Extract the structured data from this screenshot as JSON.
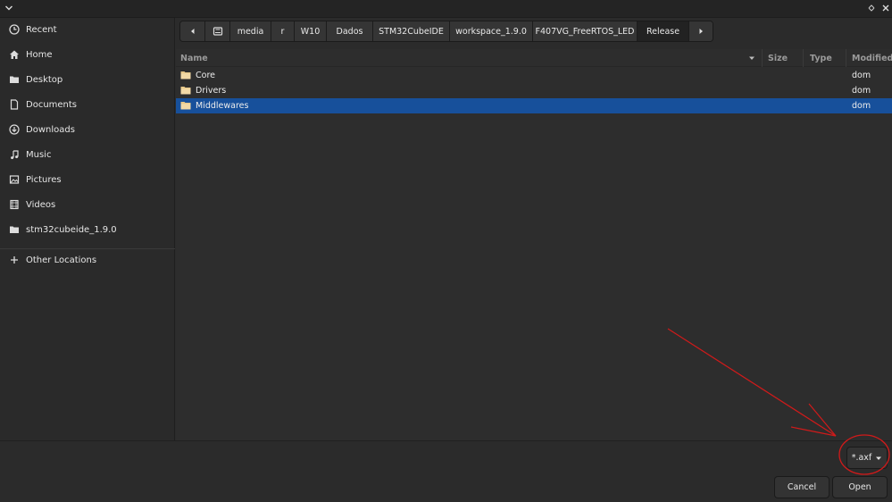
{
  "window": {
    "menu_icon": "chevron-down-icon",
    "maximize_icon": "maximize-icon",
    "close_icon": "close-icon"
  },
  "sidebar": {
    "items": [
      {
        "label": "Recent",
        "icon": "clock-icon"
      },
      {
        "label": "Home",
        "icon": "home-icon"
      },
      {
        "label": "Desktop",
        "icon": "folder-icon"
      },
      {
        "label": "Documents",
        "icon": "document-icon"
      },
      {
        "label": "Downloads",
        "icon": "download-icon"
      },
      {
        "label": "Music",
        "icon": "music-icon"
      },
      {
        "label": "Pictures",
        "icon": "pictures-icon"
      },
      {
        "label": "Videos",
        "icon": "videos-icon"
      },
      {
        "label": "stm32cubeide_1.9.0",
        "icon": "folder-icon"
      },
      {
        "label": "Other Locations",
        "icon": "plus-icon"
      }
    ]
  },
  "pathbar": {
    "crumbs": [
      "media",
      "r",
      "W10",
      "Dados",
      "STM32CubeIDE",
      "workspace_1.9.0",
      "F407VG_FreeRTOS_LED",
      "Release"
    ],
    "active": "Release"
  },
  "columns": {
    "name": "Name",
    "size": "Size",
    "type": "Type",
    "modified": "Modified"
  },
  "files": [
    {
      "name": "Core",
      "modified": "dom",
      "selected": false
    },
    {
      "name": "Drivers",
      "modified": "dom",
      "selected": false
    },
    {
      "name": "Middlewares",
      "modified": "dom",
      "selected": true
    }
  ],
  "filter": {
    "value": "*.axf"
  },
  "buttons": {
    "cancel": "Cancel",
    "open": "Open"
  },
  "colors": {
    "selection": "#17509b",
    "folder": "#e8c98a",
    "annotation": "#d11a1a"
  }
}
